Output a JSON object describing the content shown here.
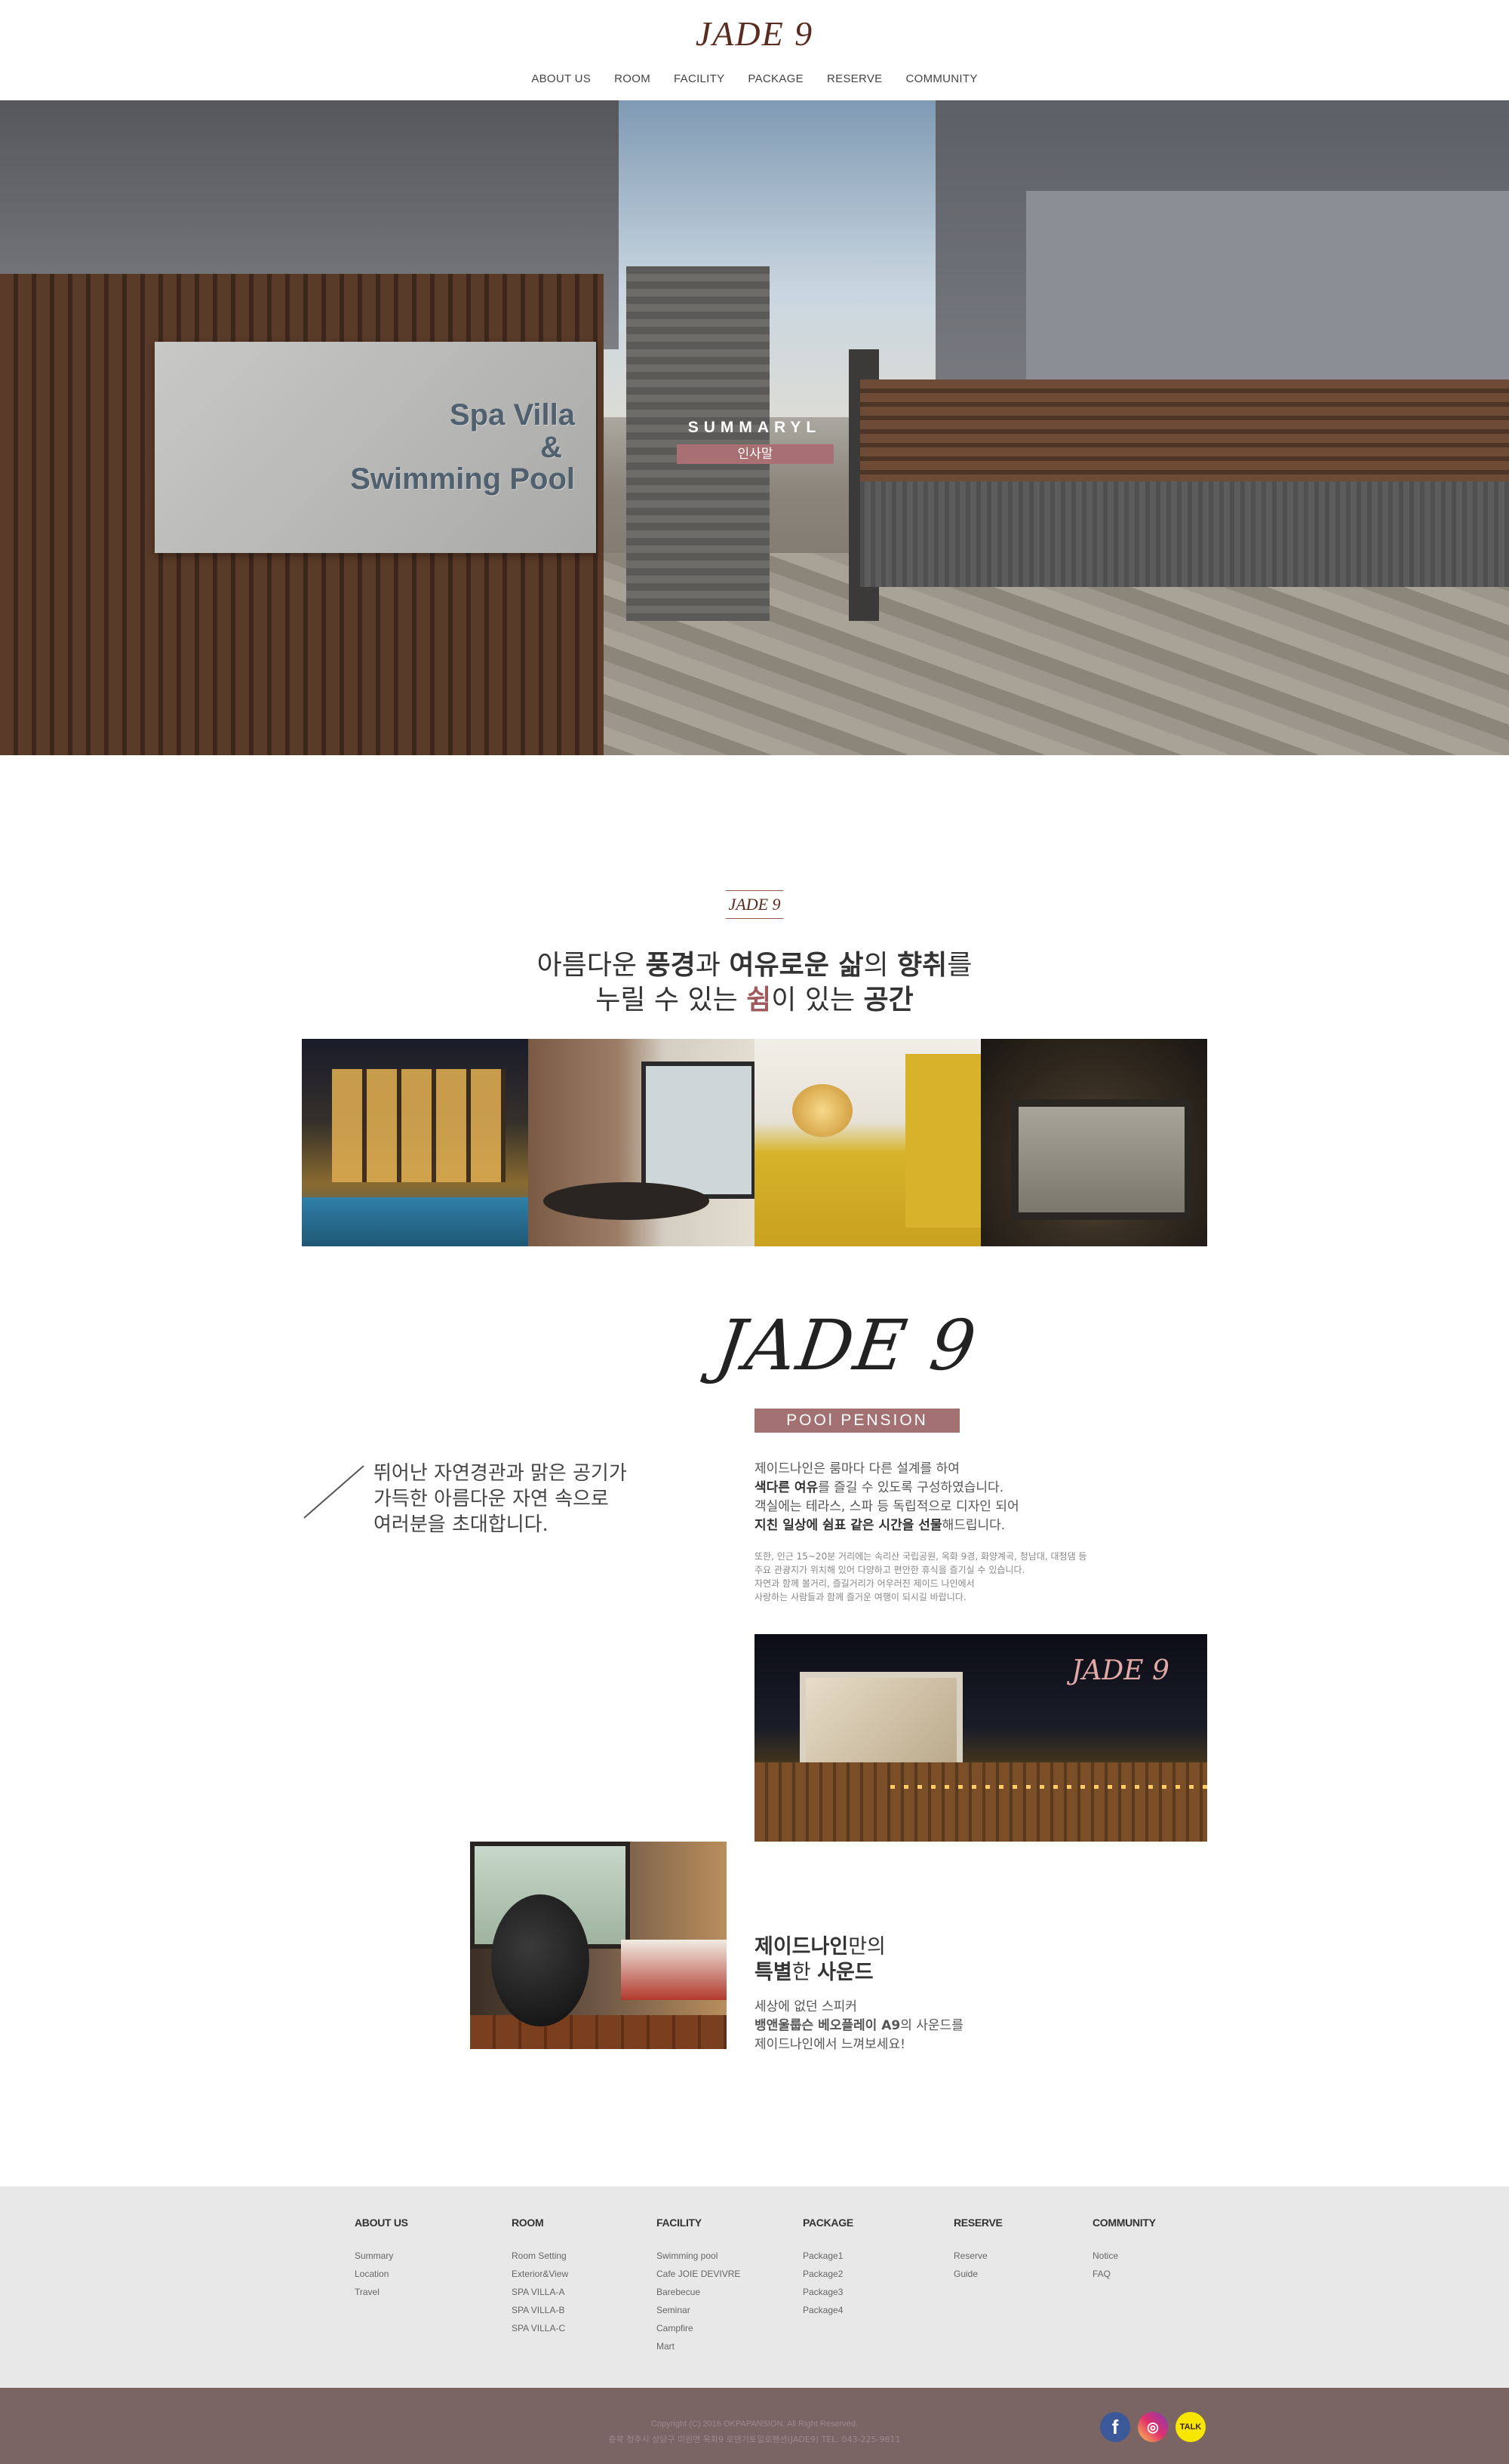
{
  "header": {
    "logo": "JADE 9",
    "nav": [
      "ABOUT US",
      "ROOM",
      "FACILITY",
      "PACKAGE",
      "RESERVE",
      "COMMUNITY"
    ]
  },
  "hero": {
    "title": "SUMMARYL",
    "badge": "인사말",
    "sign_line1": "Spa Villa",
    "sign_line2": "&",
    "sign_line3": "Swimming Pool"
  },
  "intro": {
    "logo": "JADE 9",
    "line1": {
      "a": "아름다운 ",
      "b": "풍경",
      "c": "과 ",
      "d": "여유로운 삶",
      "e": "의 ",
      "f": "향취",
      "g": "를"
    },
    "line2": {
      "a": "누릴 수 있는 ",
      "b": "쉼",
      "c": "이 있는 ",
      "d": "공간"
    }
  },
  "pension": {
    "script_logo": "JADE 9",
    "badge": "POOl PENSION",
    "quote": [
      "뛰어난 자연경관과 맑은 공기가",
      "가득한 아름다운 자연 속으로",
      "여러분을 초대합니다."
    ],
    "desc1": {
      "a": "제이드나인은 룸마다 다른 설계를 하여"
    },
    "desc2": {
      "a": "색다른 여유",
      "b": "를 즐길 수 있도록 구성하였습니다."
    },
    "desc3": {
      "a": "객실에는 테라스, 스파 등 독립적으로 디자인 되어"
    },
    "desc4": {
      "a": "지친 일상에 쉼표 같은 시간을 선물",
      "b": "해드립니다."
    },
    "small": [
      "또한, 인근 15~20분 거리에는 속리산 국립공원, 옥화 9경, 화양계곡, 청남대, 대청댐 등",
      "주요 관광지가 위치해 있어 다양하고 편안한 휴식을 즐기실 수 있습니다.",
      "자연과 함께 볼거리, 즐길거리가 어우러진 제이드 나인에서",
      "사랑하는 사람들과 함께 즐거운 여행이 되시길 바랍니다."
    ],
    "cinema_logo": "JADE 9"
  },
  "sound": {
    "title1": {
      "a": "제이드나인",
      "b": "만의"
    },
    "title2": {
      "a": "특별",
      "b": "한 ",
      "c": "사운드"
    },
    "desc1": "세상에 없던 스피커",
    "desc2": {
      "a": "뱅앤울룹슨 베오플레이 A9",
      "b": "의 사운드를"
    },
    "desc3": "제이드나인에서 느껴보세요!"
  },
  "footer": {
    "columns": [
      {
        "heading": "ABOUT US",
        "items": [
          "Summary",
          "Location",
          "Travel"
        ]
      },
      {
        "heading": "ROOM",
        "items": [
          "Room Setting",
          "Exterior&View",
          "SPA VILLA-A",
          "SPA VILLA-B",
          "SPA VILLA-C"
        ]
      },
      {
        "heading": "FACILITY",
        "items": [
          "Swimming pool",
          "Cafe JOIE DEVIVRE",
          "Barebecue",
          "Seminar",
          "Campfire",
          "Mart"
        ]
      },
      {
        "heading": "PACKAGE",
        "items": [
          "Package1",
          "Package2",
          "Package3",
          "Package4"
        ]
      },
      {
        "heading": "RESERVE",
        "items": [
          "Reserve",
          "Guide"
        ]
      },
      {
        "heading": "COMMUNITY",
        "items": [
          "Notice",
          "FAQ"
        ]
      }
    ],
    "copyright": "Copyright (C) 2016 OKPAPANSION. All Right Reserved.",
    "address": "충북 청주시 상당구 미원면 옥화9 로덴기토일로펜션(JADE9) TEL: 043-225-9811",
    "social": {
      "facebook": "f",
      "instagram": "◎",
      "kakao": "TALK"
    }
  },
  "colors": {
    "brand": "#5a2c1f",
    "accent": "#a47173",
    "footer_bar": "#7a6464"
  }
}
